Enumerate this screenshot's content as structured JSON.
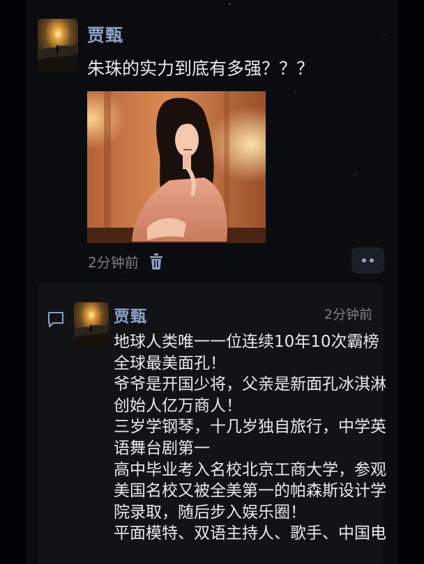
{
  "post": {
    "author": "贾甄",
    "text": "朱珠的实力到底有多强？？？",
    "time": "2分钟前"
  },
  "icons": {
    "delete": "trash-icon",
    "more": "more-dots-icon",
    "comment": "comment-bubble-icon"
  },
  "comment": {
    "author": "贾甄",
    "time": "2分钟前",
    "lines": [
      "地球人类唯一一位连续10年10次霸榜",
      "全球最美面孔！",
      "爷爷是开国少将，父亲是新面孔冰淇淋",
      "创始人亿万商人！",
      "三岁学钢琴，十几岁独自旅行，中学英",
      "语舞台剧第一",
      "高中毕业考入名校北京工商大学，参观",
      "美国名校又被全美第一的帕森斯设计学",
      "院录取，随后步入娱乐圈！",
      "平面模特、双语主持人、歌手、中国电"
    ]
  },
  "colors": {
    "background": "#0b0c0f",
    "author_name": "#8ea2c8",
    "body_text": "#e9eaee",
    "meta_text": "#7b7f89",
    "comment_panel": "#121317"
  }
}
